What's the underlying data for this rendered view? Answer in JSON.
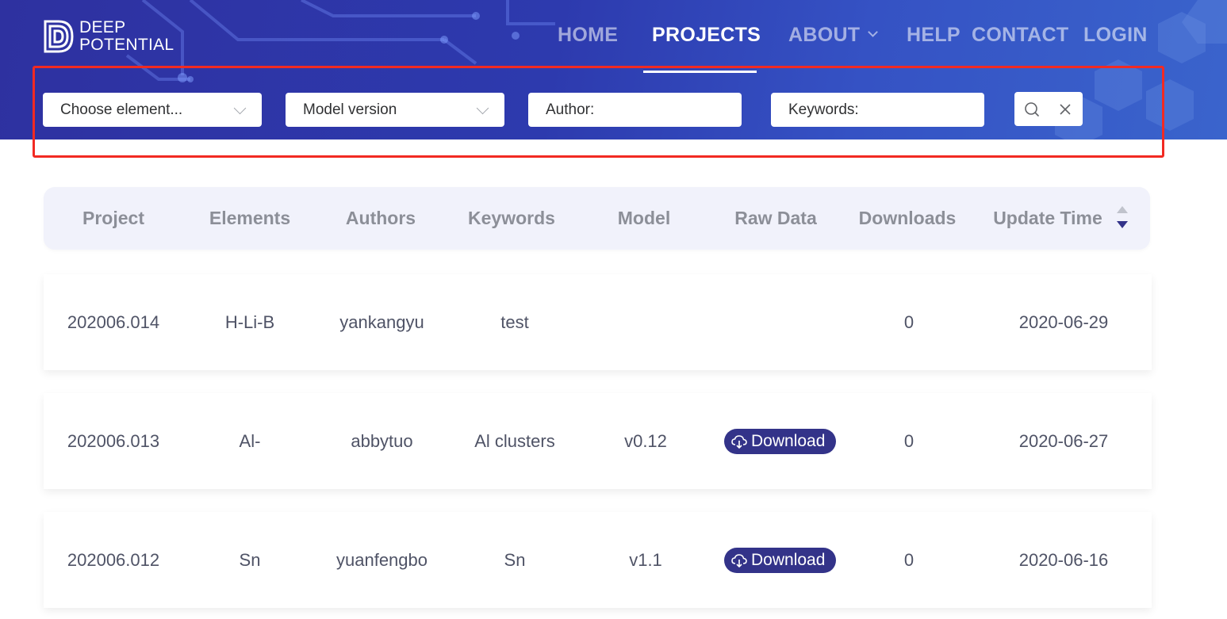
{
  "brand": {
    "line1": "DEEP",
    "line2": "POTENTIAL"
  },
  "nav": {
    "home": "HOME",
    "projects": "PROJECTS",
    "about": "ABOUT",
    "help": "HELP",
    "contact": "CONTACT",
    "login": "LOGIN",
    "active": "PROJECTS"
  },
  "filters": {
    "element": "Choose element...",
    "model_version": "Model version",
    "author_placeholder": "Author:",
    "keywords_placeholder": "Keywords:",
    "search_icon": "search-icon",
    "clear_icon": "close-icon"
  },
  "table": {
    "headers": {
      "project": "Project",
      "elements": "Elements",
      "authors": "Authors",
      "keywords": "Keywords",
      "model": "Model",
      "raw_data": "Raw Data",
      "downloads": "Downloads",
      "update_time": "Update Time"
    },
    "sort_icon": "sort-caret-icon",
    "rows": [
      {
        "project": "202006.014",
        "elements": "H-Li-B",
        "authors": "yankangyu",
        "keywords": "test",
        "model": "",
        "raw_data": "",
        "downloads": "0",
        "update_time": "2020-06-29"
      },
      {
        "project": "202006.013",
        "elements": "Al-",
        "authors": "abbytuo",
        "keywords": "Al clusters",
        "model": "v0.12",
        "raw_data": "Download",
        "downloads": "0",
        "update_time": "2020-06-27"
      },
      {
        "project": "202006.012",
        "elements": "Sn",
        "authors": "yuanfengbo",
        "keywords": "Sn",
        "model": "v1.1",
        "raw_data": "Download",
        "downloads": "0",
        "update_time": "2020-06-16"
      }
    ]
  },
  "colors": {
    "header_bg": "#2e31a0",
    "highlight_border": "#f22a22",
    "download_button": "#333389",
    "table_header_bg": "#f1f2fb"
  }
}
